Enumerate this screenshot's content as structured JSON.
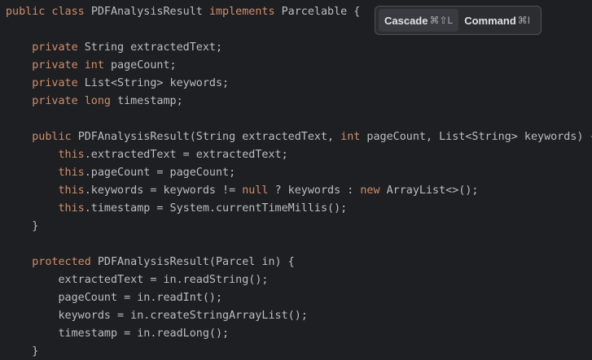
{
  "popup": {
    "cascade": {
      "label": "Cascade",
      "shortcut": "⌘⇧L"
    },
    "command": {
      "label": "Command",
      "shortcut": "⌘I"
    }
  },
  "code": {
    "lines": [
      {
        "selected": "full",
        "tokens": [
          {
            "t": "public class ",
            "c": "kw"
          },
          {
            "t": "PDFAnalysisResult ",
            "c": "pl"
          },
          {
            "t": "implements ",
            "c": "kw"
          },
          {
            "t": "Parcelable {",
            "c": "pl"
          }
        ]
      },
      {
        "selected": "full",
        "tokens": []
      },
      {
        "selected": "full",
        "tokens": [
          {
            "t": "    private ",
            "c": "kw"
          },
          {
            "t": "String extractedText;",
            "c": "pl"
          }
        ]
      },
      {
        "selected": "full",
        "tokens": [
          {
            "t": "    private ",
            "c": "kw"
          },
          {
            "t": "int ",
            "c": "kw"
          },
          {
            "t": "pageCount;",
            "c": "pl"
          }
        ]
      },
      {
        "selected": "full",
        "tokens": [
          {
            "t": "    private ",
            "c": "kw"
          },
          {
            "t": "List<String> keywords;",
            "c": "pl"
          }
        ]
      },
      {
        "selected": "full",
        "tokens": [
          {
            "t": "    private ",
            "c": "kw"
          },
          {
            "t": "long ",
            "c": "kw"
          },
          {
            "t": "timestamp;",
            "c": "pl"
          }
        ]
      },
      {
        "selected": "full",
        "tokens": []
      },
      {
        "selected": "full",
        "tokens": [
          {
            "t": "    public ",
            "c": "kw"
          },
          {
            "t": "PDFAnalysisResult(String extractedText, ",
            "c": "pl"
          },
          {
            "t": "int ",
            "c": "kw"
          },
          {
            "t": "pageCount, List<String> keywords) {",
            "c": "pl"
          }
        ]
      },
      {
        "selected": "full",
        "tokens": [
          {
            "t": "        this",
            "c": "kw"
          },
          {
            "t": ".extractedText = extractedText;",
            "c": "pl"
          }
        ]
      },
      {
        "selected": "full",
        "tokens": [
          {
            "t": "        this",
            "c": "kw"
          },
          {
            "t": ".pageCount = pageCount;",
            "c": "pl"
          }
        ]
      },
      {
        "selected": "full",
        "tokens": [
          {
            "t": "        this",
            "c": "kw"
          },
          {
            "t": ".keywords = keywords != ",
            "c": "pl"
          },
          {
            "t": "null",
            "c": "kw"
          },
          {
            "t": " ? keywords : ",
            "c": "pl"
          },
          {
            "t": "new ",
            "c": "kw"
          },
          {
            "t": "ArrayList<>();",
            "c": "pl"
          }
        ]
      },
      {
        "selected": "full",
        "tokens": [
          {
            "t": "        this",
            "c": "kw"
          },
          {
            "t": ".timestamp = System.currentTimeMillis();",
            "c": "pl"
          }
        ]
      },
      {
        "selected": "full",
        "tokens": [
          {
            "t": "    }",
            "c": "pl"
          }
        ]
      },
      {
        "selected": "full",
        "tokens": []
      },
      {
        "selected": "full",
        "tokens": [
          {
            "t": "    protected ",
            "c": "kw"
          },
          {
            "t": "PDFAnalysisResult(Parcel in) {",
            "c": "pl"
          }
        ]
      },
      {
        "selected": "full",
        "tokens": [
          {
            "t": "        extractedText = in.readString();",
            "c": "pl"
          }
        ]
      },
      {
        "selected": "full",
        "tokens": [
          {
            "t": "        pageCount = in.readInt();",
            "c": "pl"
          }
        ]
      },
      {
        "selected": "full",
        "tokens": [
          {
            "t": "        keywords = in.createStringArrayList();",
            "c": "pl"
          }
        ]
      },
      {
        "selected": "full",
        "tokens": [
          {
            "t": "        timestamp = in.readLong();",
            "c": "pl"
          }
        ]
      },
      {
        "selected": "partial",
        "tokens": [
          {
            "t": "    }",
            "c": "pl"
          }
        ]
      }
    ]
  },
  "colors": {
    "background": "#1e1f22",
    "selection": "#214283",
    "keyword": "#cf8e6d",
    "plain": "#bcbec4"
  }
}
